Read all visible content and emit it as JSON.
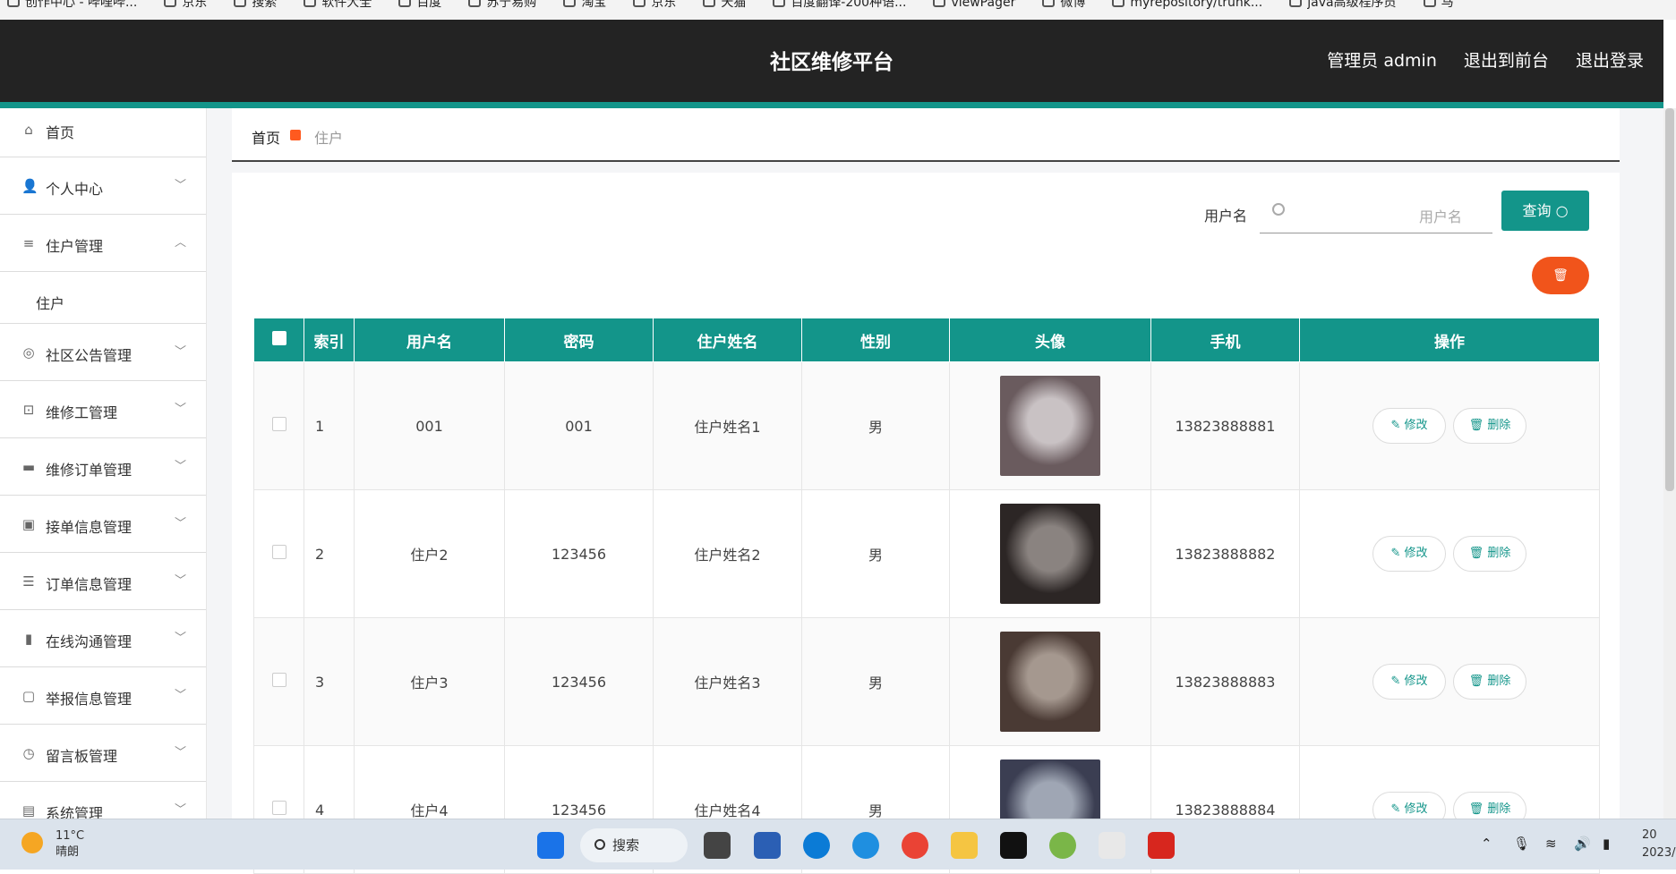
{
  "bookmarks": [
    "创作中心 - 哔哩哔...",
    "京东",
    "搜索",
    "软件大全",
    "百度",
    "苏宁易购",
    "淘宝",
    "京东",
    "天猫",
    "百度翻译-200种语...",
    "viewPager",
    "微博",
    "myrepository/trunk...",
    "java高级程序员",
    "马"
  ],
  "header": {
    "title": "社区维修平台",
    "admin": "管理员 admin",
    "front": "退出到前台",
    "logout": "退出登录"
  },
  "sidebar": {
    "home": "首页",
    "items": [
      {
        "label": "个人中心"
      },
      {
        "label": "住户管理"
      },
      {
        "sub": "住户"
      },
      {
        "label": "社区公告管理"
      },
      {
        "label": "维修工管理"
      },
      {
        "label": "维修订单管理"
      },
      {
        "label": "接单信息管理"
      },
      {
        "label": "订单信息管理"
      },
      {
        "label": "在线沟通管理"
      },
      {
        "label": "举报信息管理"
      },
      {
        "label": "留言板管理"
      },
      {
        "label": "系统管理"
      }
    ]
  },
  "breadcrumb": {
    "home": "首页",
    "current": "住户"
  },
  "search": {
    "label": "用户名",
    "placeholder": "用户名",
    "button": "查询"
  },
  "table": {
    "headers": [
      "索引",
      "用户名",
      "密码",
      "住户姓名",
      "性别",
      "头像",
      "手机",
      "操作"
    ],
    "rows": [
      {
        "idx": "1",
        "user": "001",
        "pwd": "001",
        "name": "住户姓名1",
        "sex": "男",
        "phone": "13823888881"
      },
      {
        "idx": "2",
        "user": "住户2",
        "pwd": "123456",
        "name": "住户姓名2",
        "sex": "男",
        "phone": "13823888882"
      },
      {
        "idx": "3",
        "user": "住户3",
        "pwd": "123456",
        "name": "住户姓名3",
        "sex": "男",
        "phone": "13823888883"
      },
      {
        "idx": "4",
        "user": "住户4",
        "pwd": "123456",
        "name": "住户姓名4",
        "sex": "男",
        "phone": "13823888884"
      }
    ],
    "edit": "修改",
    "del": "删除"
  },
  "taskbar": {
    "temp": "11°C",
    "weather": "晴朗",
    "search": "搜索",
    "clock1": "20",
    "clock2": "2023/"
  }
}
